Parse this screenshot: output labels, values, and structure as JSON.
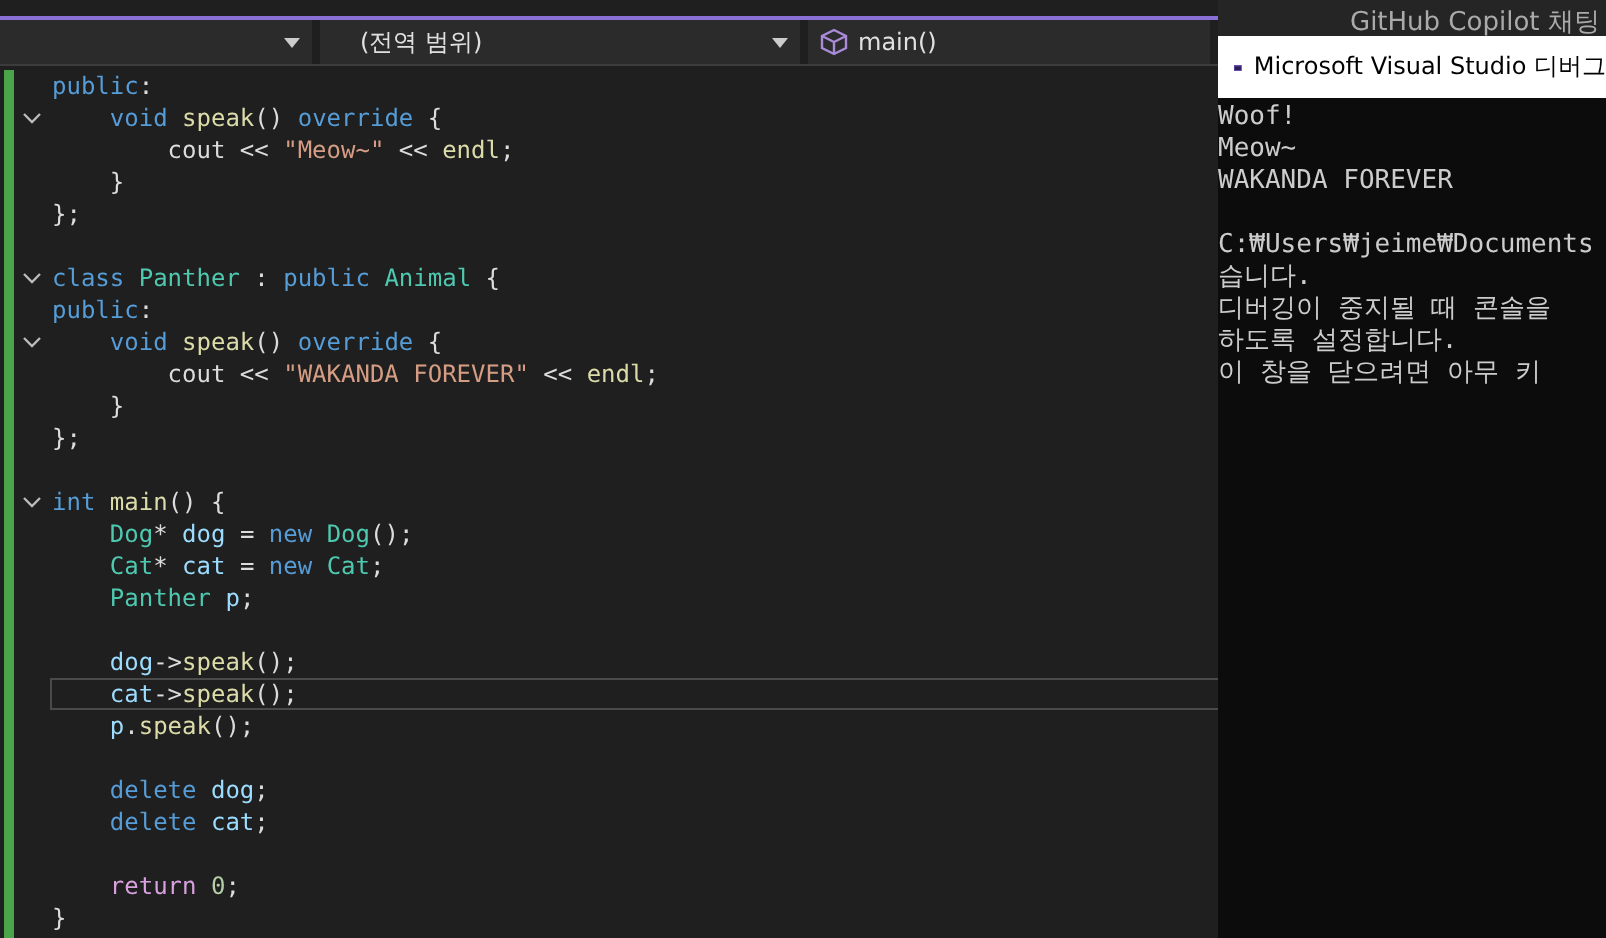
{
  "navigation_bar": {
    "dropdowns": [
      {
        "kind": "plain"
      },
      {
        "kind": "plain",
        "label": "(전역 범위)"
      },
      {
        "kind": "function",
        "label": "main()"
      }
    ]
  },
  "editor": {
    "lines": [
      {
        "fold": false,
        "current": false,
        "tokens": [
          {
            "kind": "keyword",
            "text": "public"
          },
          {
            "kind": "plain",
            "text": ":"
          }
        ]
      },
      {
        "fold": true,
        "current": false,
        "tokens": [
          {
            "kind": "keyword",
            "text": "    void"
          },
          {
            "kind": "function",
            "text": " speak"
          },
          {
            "kind": "plain",
            "text": "() "
          },
          {
            "kind": "keyword",
            "text": "override"
          },
          {
            "kind": "plain",
            "text": " {"
          }
        ]
      },
      {
        "fold": false,
        "current": false,
        "tokens": [
          {
            "kind": "plain",
            "text": "        cout << "
          },
          {
            "kind": "string",
            "text": "\"Meow~\""
          },
          {
            "kind": "plain",
            "text": " << "
          },
          {
            "kind": "function",
            "text": "endl"
          },
          {
            "kind": "plain",
            "text": ";"
          }
        ]
      },
      {
        "fold": false,
        "current": false,
        "tokens": [
          {
            "kind": "plain",
            "text": "    }"
          }
        ]
      },
      {
        "fold": false,
        "current": false,
        "tokens": [
          {
            "kind": "plain",
            "text": "};"
          }
        ]
      },
      {
        "fold": false,
        "current": false
      },
      {
        "fold": true,
        "current": false,
        "tokens": [
          {
            "kind": "keyword",
            "text": "class"
          },
          {
            "kind": "type",
            "text": " Panther"
          },
          {
            "kind": "plain",
            "text": " : "
          },
          {
            "kind": "keyword",
            "text": "public"
          },
          {
            "kind": "type",
            "text": " Animal"
          },
          {
            "kind": "plain",
            "text": " {"
          }
        ]
      },
      {
        "fold": false,
        "current": false,
        "tokens": [
          {
            "kind": "keyword",
            "text": "public"
          },
          {
            "kind": "plain",
            "text": ":"
          }
        ]
      },
      {
        "fold": true,
        "current": false,
        "tokens": [
          {
            "kind": "keyword",
            "text": "    void"
          },
          {
            "kind": "function",
            "text": " speak"
          },
          {
            "kind": "plain",
            "text": "() "
          },
          {
            "kind": "keyword",
            "text": "override"
          },
          {
            "kind": "plain",
            "text": " {"
          }
        ]
      },
      {
        "fold": false,
        "current": false,
        "tokens": [
          {
            "kind": "plain",
            "text": "        cout << "
          },
          {
            "kind": "string",
            "text": "\"WAKANDA FOREVER\""
          },
          {
            "kind": "plain",
            "text": " << "
          },
          {
            "kind": "function",
            "text": "endl"
          },
          {
            "kind": "plain",
            "text": ";"
          }
        ]
      },
      {
        "fold": false,
        "current": false,
        "tokens": [
          {
            "kind": "plain",
            "text": "    }"
          }
        ]
      },
      {
        "fold": false,
        "current": false,
        "tokens": [
          {
            "kind": "plain",
            "text": "};"
          }
        ]
      },
      {
        "fold": false,
        "current": false
      },
      {
        "fold": true,
        "current": false,
        "tokens": [
          {
            "kind": "keyword",
            "text": "int"
          },
          {
            "kind": "function",
            "text": " main"
          },
          {
            "kind": "plain",
            "text": "() {"
          }
        ]
      },
      {
        "fold": false,
        "current": false,
        "tokens": [
          {
            "kind": "type",
            "text": "    Dog"
          },
          {
            "kind": "plain",
            "text": "* "
          },
          {
            "kind": "variable",
            "text": "dog"
          },
          {
            "kind": "plain",
            "text": " = "
          },
          {
            "kind": "keyword",
            "text": "new"
          },
          {
            "kind": "type",
            "text": " Dog"
          },
          {
            "kind": "plain",
            "text": "();"
          }
        ]
      },
      {
        "fold": false,
        "current": false,
        "tokens": [
          {
            "kind": "type",
            "text": "    Cat"
          },
          {
            "kind": "plain",
            "text": "* "
          },
          {
            "kind": "variable",
            "text": "cat"
          },
          {
            "kind": "plain",
            "text": " = "
          },
          {
            "kind": "keyword",
            "text": "new"
          },
          {
            "kind": "type",
            "text": " Cat"
          },
          {
            "kind": "plain",
            "text": ";"
          }
        ]
      },
      {
        "fold": false,
        "current": false,
        "tokens": [
          {
            "kind": "type",
            "text": "    Panther"
          },
          {
            "kind": "variable",
            "text": " p"
          },
          {
            "kind": "plain",
            "text": ";"
          }
        ]
      },
      {
        "fold": false,
        "current": false
      },
      {
        "fold": false,
        "current": false,
        "tokens": [
          {
            "kind": "variable",
            "text": "    dog"
          },
          {
            "kind": "plain",
            "text": "->"
          },
          {
            "kind": "function",
            "text": "speak"
          },
          {
            "kind": "plain",
            "text": "();"
          }
        ]
      },
      {
        "fold": false,
        "current": true,
        "tokens": [
          {
            "kind": "variable",
            "text": "    cat"
          },
          {
            "kind": "plain",
            "text": "->"
          },
          {
            "kind": "function",
            "text": "speak"
          },
          {
            "kind": "plain",
            "text": "();"
          }
        ]
      },
      {
        "fold": false,
        "current": false,
        "tokens": [
          {
            "kind": "variable",
            "text": "    p"
          },
          {
            "kind": "plain",
            "text": "."
          },
          {
            "kind": "function",
            "text": "speak"
          },
          {
            "kind": "plain",
            "text": "();"
          }
        ]
      },
      {
        "fold": false,
        "current": false
      },
      {
        "fold": false,
        "current": false,
        "tokens": [
          {
            "kind": "keyword",
            "text": "    delete"
          },
          {
            "kind": "variable",
            "text": " dog"
          },
          {
            "kind": "plain",
            "text": ";"
          }
        ]
      },
      {
        "fold": false,
        "current": false,
        "tokens": [
          {
            "kind": "keyword",
            "text": "    delete"
          },
          {
            "kind": "variable",
            "text": " cat"
          },
          {
            "kind": "plain",
            "text": ";"
          }
        ]
      },
      {
        "fold": false,
        "current": false
      },
      {
        "fold": false,
        "current": false,
        "tokens": [
          {
            "kind": "control",
            "text": "    return"
          },
          {
            "kind": "number",
            "text": " 0"
          },
          {
            "kind": "plain",
            "text": ";"
          }
        ]
      },
      {
        "fold": false,
        "current": false,
        "tokens": [
          {
            "kind": "plain",
            "text": "}"
          }
        ]
      }
    ]
  },
  "side_panel": {
    "title": "GitHub Copilot 채팅"
  },
  "console": {
    "title": "Microsoft Visual Studio 디버그",
    "lines": [
      {
        "kind": "text",
        "text": "Woof!"
      },
      {
        "kind": "text",
        "text": "Meow~"
      },
      {
        "kind": "text",
        "text": "WAKANDA FOREVER"
      },
      {
        "kind": "blank"
      },
      {
        "kind": "text",
        "text": "C:₩Users₩jeime₩Documents"
      },
      {
        "kind": "text",
        "text": "습니다."
      },
      {
        "kind": "text",
        "text": "디버깅이 중지될 때 콘솔을"
      },
      {
        "kind": "text",
        "text": "하도록 설정합니다."
      },
      {
        "kind": "text",
        "text": "이 창을 닫으려면 아무 키"
      }
    ]
  }
}
